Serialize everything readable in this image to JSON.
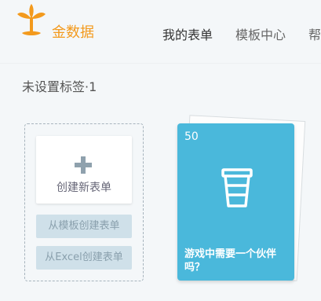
{
  "header": {
    "brand": "金数据",
    "nav": [
      "我的表单",
      "模板中心",
      "帮"
    ]
  },
  "tag_title": "未设置标签·1",
  "create": {
    "new_form_label": "创建新表单",
    "from_template_label": "从模板创建表单",
    "from_excel_label": "从Excel创建表单"
  },
  "form_card": {
    "count": "50",
    "title": "游戏中需要一个伙伴吗？",
    "color": "#4ab8db",
    "icon": "cup-icon"
  },
  "colors": {
    "brand": "#f39a1d",
    "card": "#4ab8db"
  }
}
